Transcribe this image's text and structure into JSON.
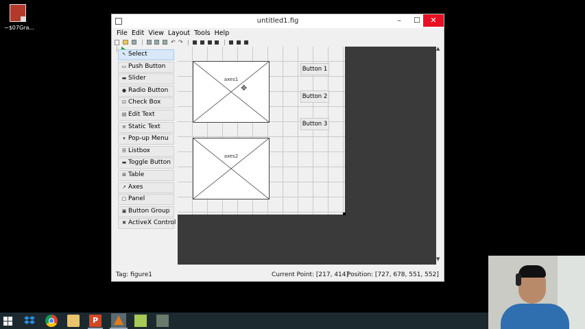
{
  "desktop": {
    "icon_label": "~$07Gra..."
  },
  "window": {
    "title": "untitled1.fig",
    "controls": {
      "minimize": "–",
      "maximize": "☐",
      "close": "✕"
    }
  },
  "menu": [
    "File",
    "Edit",
    "View",
    "Layout",
    "Tools",
    "Help"
  ],
  "palette": [
    {
      "label": "Select",
      "icon": "arrow-cursor-icon",
      "glyph": "↖",
      "selected": true
    },
    {
      "label": "Push Button",
      "icon": "push-button-icon",
      "glyph": "▭"
    },
    {
      "label": "Slider",
      "icon": "slider-icon",
      "glyph": "▬"
    },
    {
      "label": "Radio Button",
      "icon": "radio-button-icon",
      "glyph": "●"
    },
    {
      "label": "Check Box",
      "icon": "check-box-icon",
      "glyph": "☑"
    },
    {
      "label": "Edit Text",
      "icon": "edit-text-icon",
      "glyph": "▤"
    },
    {
      "label": "Static Text",
      "icon": "static-text-icon",
      "glyph": "≡"
    },
    {
      "label": "Pop-up Menu",
      "icon": "popup-menu-icon",
      "glyph": "▾"
    },
    {
      "label": "Listbox",
      "icon": "listbox-icon",
      "glyph": "☰"
    },
    {
      "label": "Toggle Button",
      "icon": "toggle-button-icon",
      "glyph": "▬"
    },
    {
      "label": "Table",
      "icon": "table-icon",
      "glyph": "⊞"
    },
    {
      "label": "Axes",
      "icon": "axes-icon",
      "glyph": "↗"
    },
    {
      "label": "Panel",
      "icon": "panel-icon",
      "glyph": "▢"
    },
    {
      "label": "Button Group",
      "icon": "button-group-icon",
      "glyph": "▣"
    },
    {
      "label": "ActiveX Control",
      "icon": "activex-icon",
      "glyph": "✖"
    }
  ],
  "canvas": {
    "axes1_label": "axes1",
    "axes2_label": "axes2",
    "buttons": [
      "Button 1",
      "Button 2",
      "Button 3"
    ]
  },
  "status": {
    "tag": "Tag: figure1",
    "current_point": "Current Point:  [217, 414]",
    "position": "Position: [727, 678, 551, 552]"
  },
  "colors": {
    "close_button": "#e81123",
    "selected_tool": "#d8e8f8",
    "run_icon": "#1aa11a",
    "canvas_dark": "#3a3a3a"
  }
}
